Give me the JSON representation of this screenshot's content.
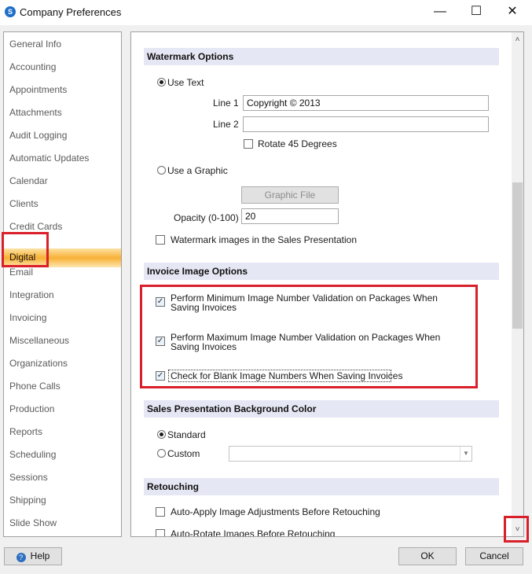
{
  "window": {
    "title": "Company Preferences",
    "minimize": "—",
    "maximize": "☐",
    "close": "✕",
    "app_icon": "S"
  },
  "sidebar": {
    "items": [
      {
        "label": "General Info"
      },
      {
        "label": "Accounting"
      },
      {
        "label": "Appointments"
      },
      {
        "label": "Attachments"
      },
      {
        "label": "Audit Logging"
      },
      {
        "label": "Automatic Updates"
      },
      {
        "label": "Calendar"
      },
      {
        "label": "Clients"
      },
      {
        "label": "Credit Cards"
      },
      {
        "label": "Digital"
      },
      {
        "label": "Email"
      },
      {
        "label": "Integration"
      },
      {
        "label": "Invoicing"
      },
      {
        "label": "Miscellaneous"
      },
      {
        "label": "Organizations"
      },
      {
        "label": "Phone Calls"
      },
      {
        "label": "Production"
      },
      {
        "label": "Reports"
      },
      {
        "label": "Scheduling"
      },
      {
        "label": "Sessions"
      },
      {
        "label": "Shipping"
      },
      {
        "label": "Slide Show"
      }
    ],
    "active": "Digital"
  },
  "watermark": {
    "header": "Watermark Options",
    "use_text_label": "Use Text",
    "use_text_selected": true,
    "line1_label": "Line 1",
    "line1_value": "Copyright © 2013",
    "line2_label": "Line 2",
    "line2_value": "",
    "rotate_label": "Rotate 45 Degrees",
    "rotate_checked": false,
    "use_graphic_label": "Use a Graphic",
    "use_graphic_selected": false,
    "graphic_file_button": "Graphic File",
    "opacity_label": "Opacity (0-100)",
    "opacity_value": "20",
    "sales_presentation_label": "Watermark images in the Sales Presentation",
    "sales_presentation_checked": false
  },
  "invoice": {
    "header": "Invoice Image Options",
    "min_validation_label": "Perform Minimum Image Number Validation on Packages When Saving Invoices",
    "min_validation_checked": true,
    "max_validation_label": "Perform Maximum Image Number Validation on Packages When Saving Invoices",
    "max_validation_checked": true,
    "blank_check_label": "Check for Blank Image Numbers When Saving Invoices",
    "blank_check_checked": true
  },
  "background": {
    "header": "Sales Presentation Background Color",
    "standard_label": "Standard",
    "standard_selected": true,
    "custom_label": "Custom",
    "custom_selected": false,
    "custom_value": ""
  },
  "retouching": {
    "header": "Retouching",
    "auto_apply_label": "Auto-Apply Image Adjustments Before Retouching",
    "auto_apply_checked": false,
    "auto_rotate_label": "Auto-Rotate Images Before Retouching",
    "auto_rotate_checked": false
  },
  "footer": {
    "help_label": "Help",
    "ok_label": "OK",
    "cancel_label": "Cancel"
  },
  "icons": {
    "check": "✓",
    "scroll_up": "˄",
    "scroll_down": "˅",
    "dropdown": "▼",
    "help": "?"
  },
  "colors": {
    "highlight_red": "#d9202a",
    "active_item": "#f8b035",
    "section_bg": "#e6e7f4"
  }
}
